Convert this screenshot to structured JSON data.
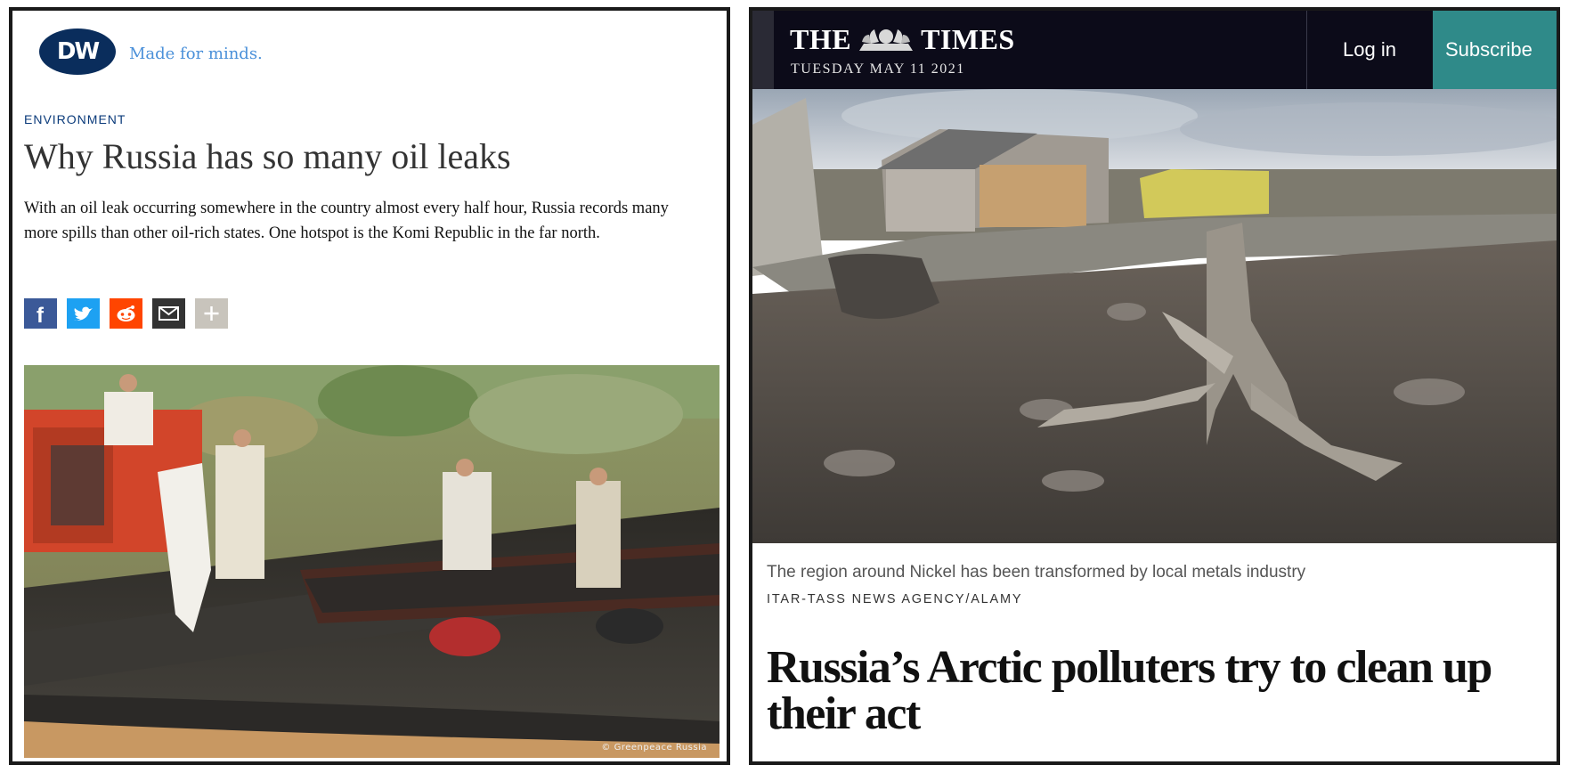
{
  "dw": {
    "logo_text": "DW",
    "slogan": "Made for minds.",
    "category": "ENVIRONMENT",
    "title": "Why Russia has so many oil leaks",
    "lead": "With an oil leak occurring somewhere in the country almost every half hour, Russia records many more spills than other oil-rich states. One hotspot is the Komi Republic in the far north.",
    "share_buttons": [
      {
        "name": "facebook",
        "icon": "facebook-icon",
        "color": "#3b5998"
      },
      {
        "name": "twitter",
        "icon": "twitter-icon",
        "color": "#1da1f2"
      },
      {
        "name": "reddit",
        "icon": "reddit-icon",
        "color": "#ff4500"
      },
      {
        "name": "email",
        "icon": "mail-icon",
        "color": "#333333"
      },
      {
        "name": "more",
        "icon": "plus-icon",
        "color": "#c8c4bc"
      }
    ],
    "photo_credit": "© Greenpeace Russia"
  },
  "times": {
    "masthead_left": "THE",
    "masthead_right": "TIMES",
    "date": "TUESDAY MAY 11 2021",
    "login_label": "Log in",
    "subscribe_label": "Subscribe",
    "caption": "The region around Nickel has been transformed by local metals industry",
    "photo_credit": "ITAR-TASS NEWS AGENCY/ALAMY",
    "headline": "Russia’s Arctic polluters try to clean up their act",
    "accent": "#2f8a89"
  }
}
